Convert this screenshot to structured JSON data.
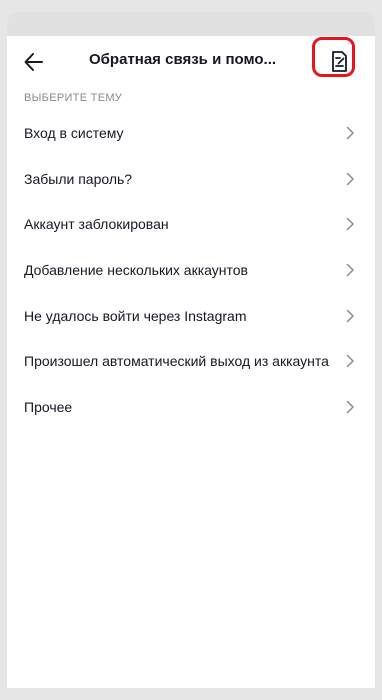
{
  "header": {
    "title": "Обратная связь и помо...",
    "back_icon": "arrow-left-icon",
    "feedback_icon": "feedback-note-icon"
  },
  "section": {
    "label": "ВЫБЕРИТЕ ТЕМУ"
  },
  "topics": [
    {
      "label": "Вход в систему"
    },
    {
      "label": "Забыли пароль?"
    },
    {
      "label": "Аккаунт заблокирован"
    },
    {
      "label": "Добавление нескольких аккаунтов"
    },
    {
      "label": "Не удалось войти через Instagram"
    },
    {
      "label": "Произошел автоматический выход из аккаунта"
    },
    {
      "label": "Прочее"
    }
  ],
  "colors": {
    "highlight": "#e8141f",
    "text": "#161823",
    "muted": "#8a8b91",
    "chevron": "#8a8b91"
  }
}
